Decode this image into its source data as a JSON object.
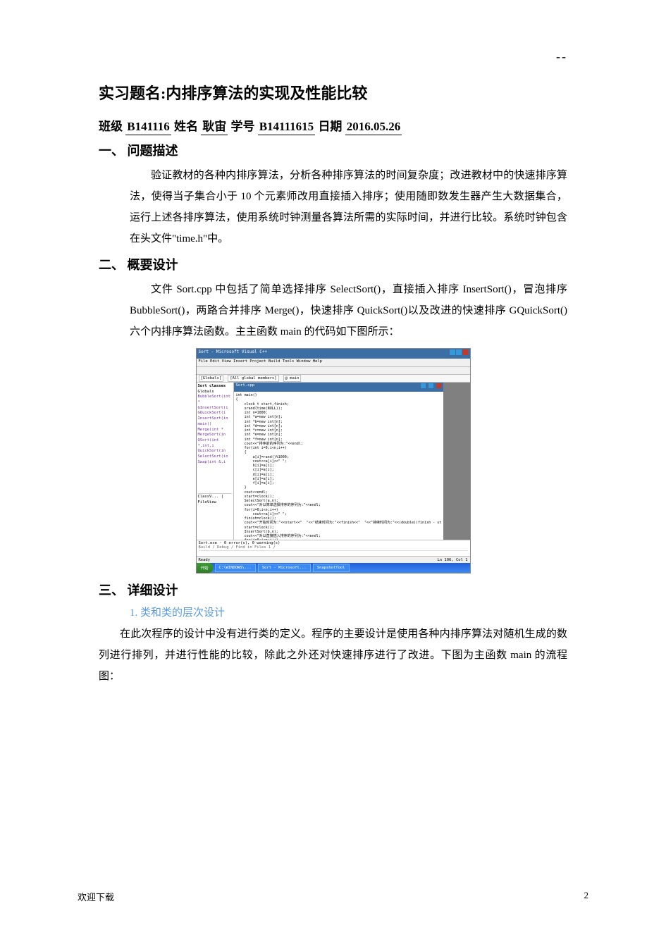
{
  "top_dashes": "--",
  "doc_title": "实习题名:内排序算法的实现及性能比较",
  "info": {
    "class_label": "班级",
    "class_value": " B141116 ",
    "name_label": "姓名",
    "name_value": "    耿宙    ",
    "id_label": "学号",
    "id_value": "   B14111615   ",
    "date_label": "日期",
    "date_value": " 2016.05.26 "
  },
  "sections": {
    "s1_head": "一、    问题描述",
    "s1_para": "验证教材的各种内排序算法，分析各种排序算法的时间复杂度；改进教材中的快速排序算法，使得当子集合小于 10 个元素师改用直接插入排序；使用随即数发生器产生大数据集合，运行上述各排序算法，使用系统时钟测量各算法所需的实际时间，并进行比较。系统时钟包含在头文件\"time.h\"中。",
    "s2_head": "二、    概要设计",
    "s2_para": "文件 Sort.cpp 中包括了简单选择排序 SelectSort()，直接插入排序 InsertSort()，冒泡排序 BubbleSort()，两路合并排序 Merge()，快速排序 QuickSort()以及改进的快速排序 GQuickSort()六个内排序算法函数。主主函数 main 的代码如下图所示：",
    "s3_head": "三、    详细设计",
    "s3_sub1": "1.    类和类的层次设计",
    "s3_para": "在此次程序的设计中没有进行类的定义。程序的主要设计是使用各种内排序算法对随机生成的数列进行排列，并进行性能的比较，除此之外还对快速排序进行了改进。下图为主函数 main 的流程图："
  },
  "ide": {
    "title": "Sort - Microsoft Visual C++",
    "menus": "File  Edit  View  Insert  Project  Build  Tools  Window  Help",
    "dd1": "[Globals]",
    "dd2": "[All global members]",
    "dd3": "@ main",
    "codetab": "Sort.cpp",
    "sidebar_root": "Sort classes",
    "sidebar_globals": "Globals",
    "sidebar_items": [
      "BubbleSort(int *",
      "GInsertSort(i",
      "GQuickSort(i",
      "InsertSort(in",
      "main()",
      "Merge(int *",
      "MergeSort(in",
      "QSort(int *,int,i",
      "QuickSort(in",
      "SelectSort(in",
      "Swap(int &,i"
    ],
    "sidebar_tabs": "ClassV... | FileView",
    "code": "int main()\n{\n    clock_t start,finish;\n    srand(time(NULL));\n    int n=1000;\n    int *a=new int[n];\n    int *b=new int[n];\n    int *d=new int[n];\n    int *c=new int[n];\n    int *e=new int[n];\n    int *f=new int[n];\n    cout<<\"排序前的序列为:\"<<endl;\n    for(int i=0;i<n;i++)\n    {\n        a[i]=rand()%1000;\n        cout<<a[i]<<\" \";\n        b[i]=a[i];\n        c[i]=a[i];\n        d[i]=a[i];\n        e[i]=a[i];\n        f[i]=a[i];\n    }\n    cout<<endl;\n    start=clock();\n    SelectSort(a,n);\n    cout<<\"对以简单选择排序的序列为:\"<<endl;\n    for(i=0;i<n;i++)\n        cout<<a[i]<<\" \";\n    finish=clock();\n    cout<<\"开始时间为:\"<<start<<\"  \"<<\"结束时间为:\"<<finish<<\"  \"<<\"持续时间为:\"<<(double)(finish - st\n    start=clock();\n    InsertSort(b,n);\n    cout<<\"对以直接插入排序的序列为:\"<<endl;\n    for(i=0;i<n;i++)\n        cout<<b[i]<<\" \";\n    finish=clock();\n    cout<<\"开始时间为:\"<<start<<\"  \"<<\"结束时间为:\"<<finish<<\"  \"<<\"持续时间为:\"<<(double)(finish - st\n    start=clock();\n    BubbleSort(c,n);\n    cout<<\"对以冒泡排序的序列为:\"<<endl;\n    for(i=0;i<n;i++)\n        cout<<c[i]<<\" \";",
    "output_msgs": "Sort.exe - 0 error(s), 0 warning(s)",
    "output_tabs": "Build / Debug / Find in Files 1 / ",
    "status_left": "Ready",
    "status_right": "Ln 106, Col 1",
    "taskbar_start": "开始",
    "taskbar_items": [
      "C:\\WINDOWS\\...",
      "Sort - Microsoft...",
      "SnapshotTool"
    ]
  },
  "footer": {
    "left": "欢迎下载",
    "right": "2"
  }
}
